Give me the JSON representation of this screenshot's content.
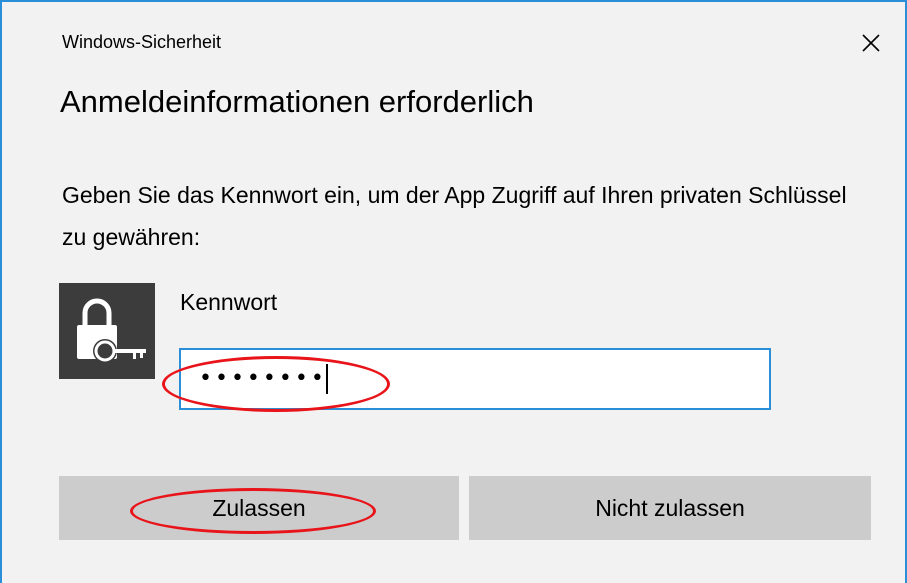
{
  "window": {
    "title": "Windows-Sicherheit",
    "close_icon": "close-icon"
  },
  "dialog": {
    "heading": "Anmeldeinformationen erforderlich",
    "description": "Geben Sie das Kennwort ein, um der App Zugriff auf Ihren privaten Schlüssel zu gewähren:",
    "credential_icon": "lock-key-icon",
    "password_label": "Kennwort",
    "password_value": "••••••••"
  },
  "buttons": {
    "allow_label": "Zulassen",
    "deny_label": "Nicht zulassen"
  },
  "colors": {
    "accent": "#2a8fd8",
    "annotation": "#e8141a",
    "button_bg": "#cccccc",
    "icon_tile": "#3c3c3c"
  }
}
